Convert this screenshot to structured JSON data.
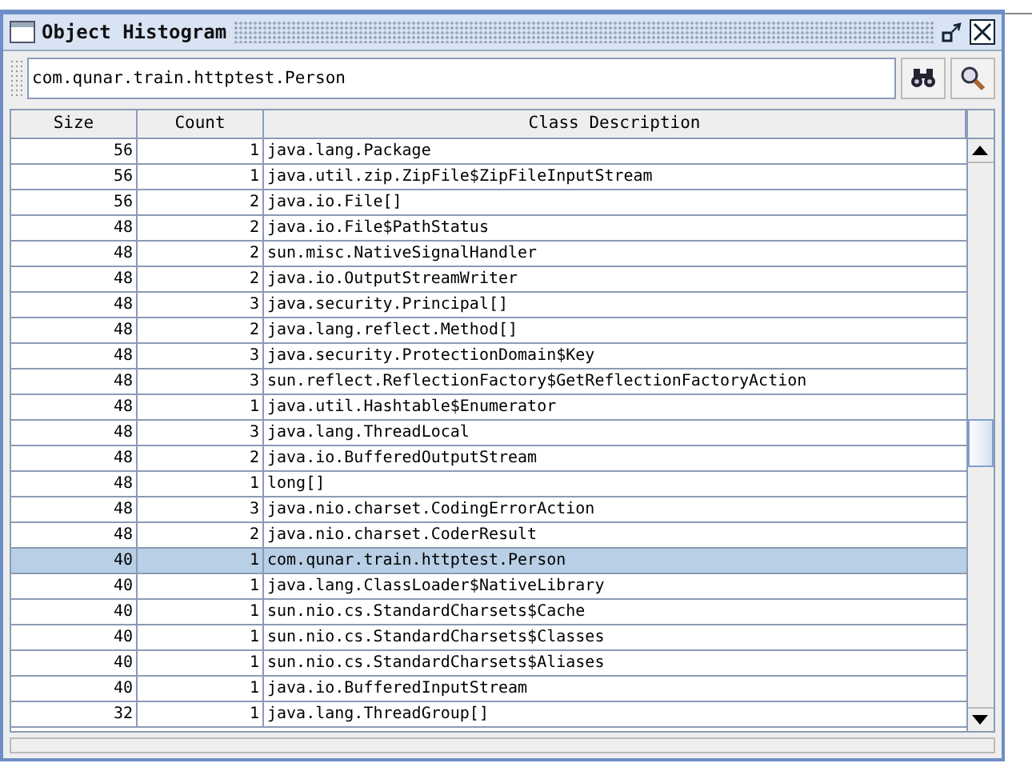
{
  "window": {
    "title": "Object Histogram"
  },
  "search": {
    "value": "com.qunar.train.httptest.Person"
  },
  "table": {
    "columns": [
      "Size",
      "Count",
      "Class Description"
    ],
    "rows": [
      {
        "size": "56",
        "count": "1",
        "class": "java.lang.Package",
        "selected": false
      },
      {
        "size": "56",
        "count": "1",
        "class": "java.util.zip.ZipFile$ZipFileInputStream",
        "selected": false
      },
      {
        "size": "56",
        "count": "2",
        "class": "java.io.File[]",
        "selected": false
      },
      {
        "size": "48",
        "count": "2",
        "class": "java.io.File$PathStatus",
        "selected": false
      },
      {
        "size": "48",
        "count": "2",
        "class": "sun.misc.NativeSignalHandler",
        "selected": false
      },
      {
        "size": "48",
        "count": "2",
        "class": "java.io.OutputStreamWriter",
        "selected": false
      },
      {
        "size": "48",
        "count": "3",
        "class": "java.security.Principal[]",
        "selected": false
      },
      {
        "size": "48",
        "count": "2",
        "class": "java.lang.reflect.Method[]",
        "selected": false
      },
      {
        "size": "48",
        "count": "3",
        "class": "java.security.ProtectionDomain$Key",
        "selected": false
      },
      {
        "size": "48",
        "count": "3",
        "class": "sun.reflect.ReflectionFactory$GetReflectionFactoryAction",
        "selected": false
      },
      {
        "size": "48",
        "count": "1",
        "class": "java.util.Hashtable$Enumerator",
        "selected": false
      },
      {
        "size": "48",
        "count": "3",
        "class": "java.lang.ThreadLocal",
        "selected": false
      },
      {
        "size": "48",
        "count": "2",
        "class": "java.io.BufferedOutputStream",
        "selected": false
      },
      {
        "size": "48",
        "count": "1",
        "class": "long[]",
        "selected": false
      },
      {
        "size": "48",
        "count": "3",
        "class": "java.nio.charset.CodingErrorAction",
        "selected": false
      },
      {
        "size": "48",
        "count": "2",
        "class": "java.nio.charset.CoderResult",
        "selected": false
      },
      {
        "size": "40",
        "count": "1",
        "class": "com.qunar.train.httptest.Person",
        "selected": true
      },
      {
        "size": "40",
        "count": "1",
        "class": "java.lang.ClassLoader$NativeLibrary",
        "selected": false
      },
      {
        "size": "40",
        "count": "1",
        "class": "sun.nio.cs.StandardCharsets$Cache",
        "selected": false
      },
      {
        "size": "40",
        "count": "1",
        "class": "sun.nio.cs.StandardCharsets$Classes",
        "selected": false
      },
      {
        "size": "40",
        "count": "1",
        "class": "sun.nio.cs.StandardCharsets$Aliases",
        "selected": false
      },
      {
        "size": "40",
        "count": "1",
        "class": "java.io.BufferedInputStream",
        "selected": false
      },
      {
        "size": "32",
        "count": "1",
        "class": "java.lang.ThreadGroup[]",
        "selected": false
      }
    ]
  }
}
